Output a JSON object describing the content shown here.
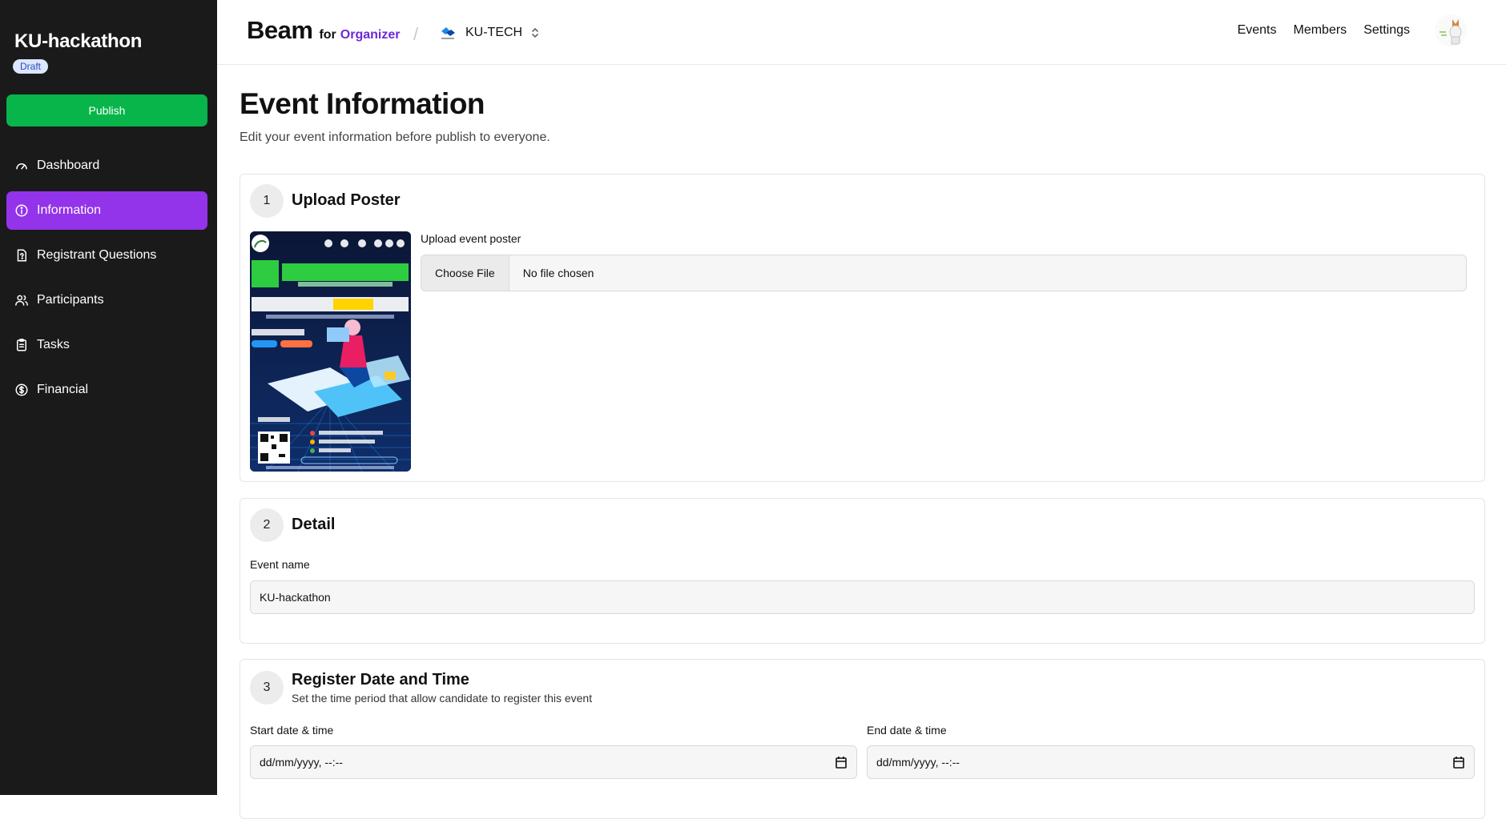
{
  "sidebar": {
    "event_title": "KU-hackathon",
    "status_badge": "Draft",
    "publish_label": "Publish",
    "items": [
      {
        "label": "Dashboard",
        "icon": "gauge-icon"
      },
      {
        "label": "Information",
        "icon": "info-icon",
        "active": true
      },
      {
        "label": "Registrant Questions",
        "icon": "question-doc-icon"
      },
      {
        "label": "Participants",
        "icon": "users-icon"
      },
      {
        "label": "Tasks",
        "icon": "clipboard-icon"
      },
      {
        "label": "Financial",
        "icon": "dollar-icon"
      }
    ]
  },
  "header": {
    "brand": "Beam",
    "brand_for": "for",
    "brand_role": "Organizer",
    "org_name": "KU-TECH",
    "nav": [
      "Events",
      "Members",
      "Settings"
    ]
  },
  "main": {
    "title": "Event Information",
    "subtitle": "Edit your event information before publish to everyone.",
    "sections": {
      "poster": {
        "number": "1",
        "title": "Upload Poster",
        "upload_label": "Upload event poster",
        "choose_file": "Choose File",
        "file_status": "No file chosen"
      },
      "detail": {
        "number": "2",
        "title": "Detail",
        "event_name_label": "Event name",
        "event_name_value": "KU-hackathon"
      },
      "register": {
        "number": "3",
        "title": "Register Date and Time",
        "description": "Set the time period that allow candidate to register this event",
        "start_label": "Start date & time",
        "start_placeholder": "dd/mm/yyyy, --:--",
        "end_label": "End date & time",
        "end_placeholder": "dd/mm/yyyy, --:--"
      }
    }
  },
  "colors": {
    "sidebar_bg": "#1a1a1a",
    "active_nav": "#9333ea",
    "publish": "#07b54a",
    "organizer_accent": "#6d28d9"
  }
}
